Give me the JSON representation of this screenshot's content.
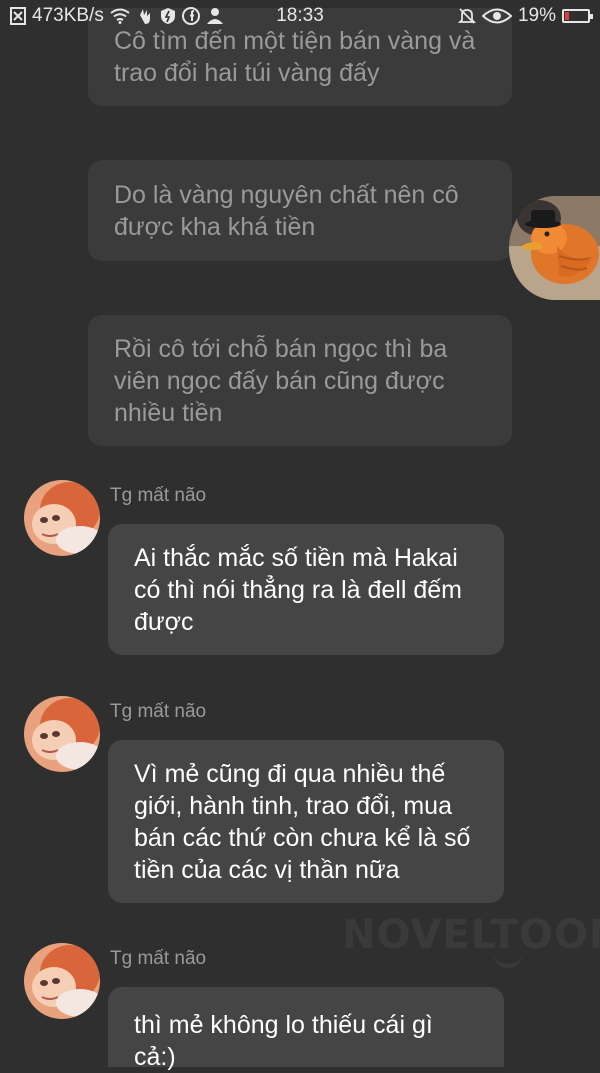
{
  "status_bar": {
    "speed": "473KB/s",
    "time": "18:33",
    "battery": "19%",
    "battery_level": 0.19
  },
  "messages": [
    {
      "text": "Cô tìm đến một tiện bán vàng và trao đổi hai túi vàng đấy"
    },
    {
      "text": "Do là vàng nguyên chất nên cô được kha khá tiền"
    },
    {
      "text": "Rồi cô tới chỗ bán ngọc thì ba viên ngọc đấy bán cũng được nhiều tiền"
    },
    {
      "sender": "Tg mất não",
      "text": "Ai thắc mắc số tiền mà Hakai có thì nói thẳng ra là đell đếm được"
    },
    {
      "sender": "Tg mất não",
      "text": "Vì mẻ cũng đi qua nhiều thế giới, hành tinh, trao đổi, mua bán các thứ còn chưa kể là số tiền của các vị thần nữa"
    },
    {
      "sender": "Tg mất não",
      "text": "thì mẻ không lo thiếu cái gì cả:)"
    }
  ],
  "watermark": "NOVELTOON",
  "colors": {
    "background": "#2f2f2f",
    "bubble_faded": "#3b3b3b",
    "bubble_active": "#454545",
    "battery_low": "#e23c3c"
  }
}
